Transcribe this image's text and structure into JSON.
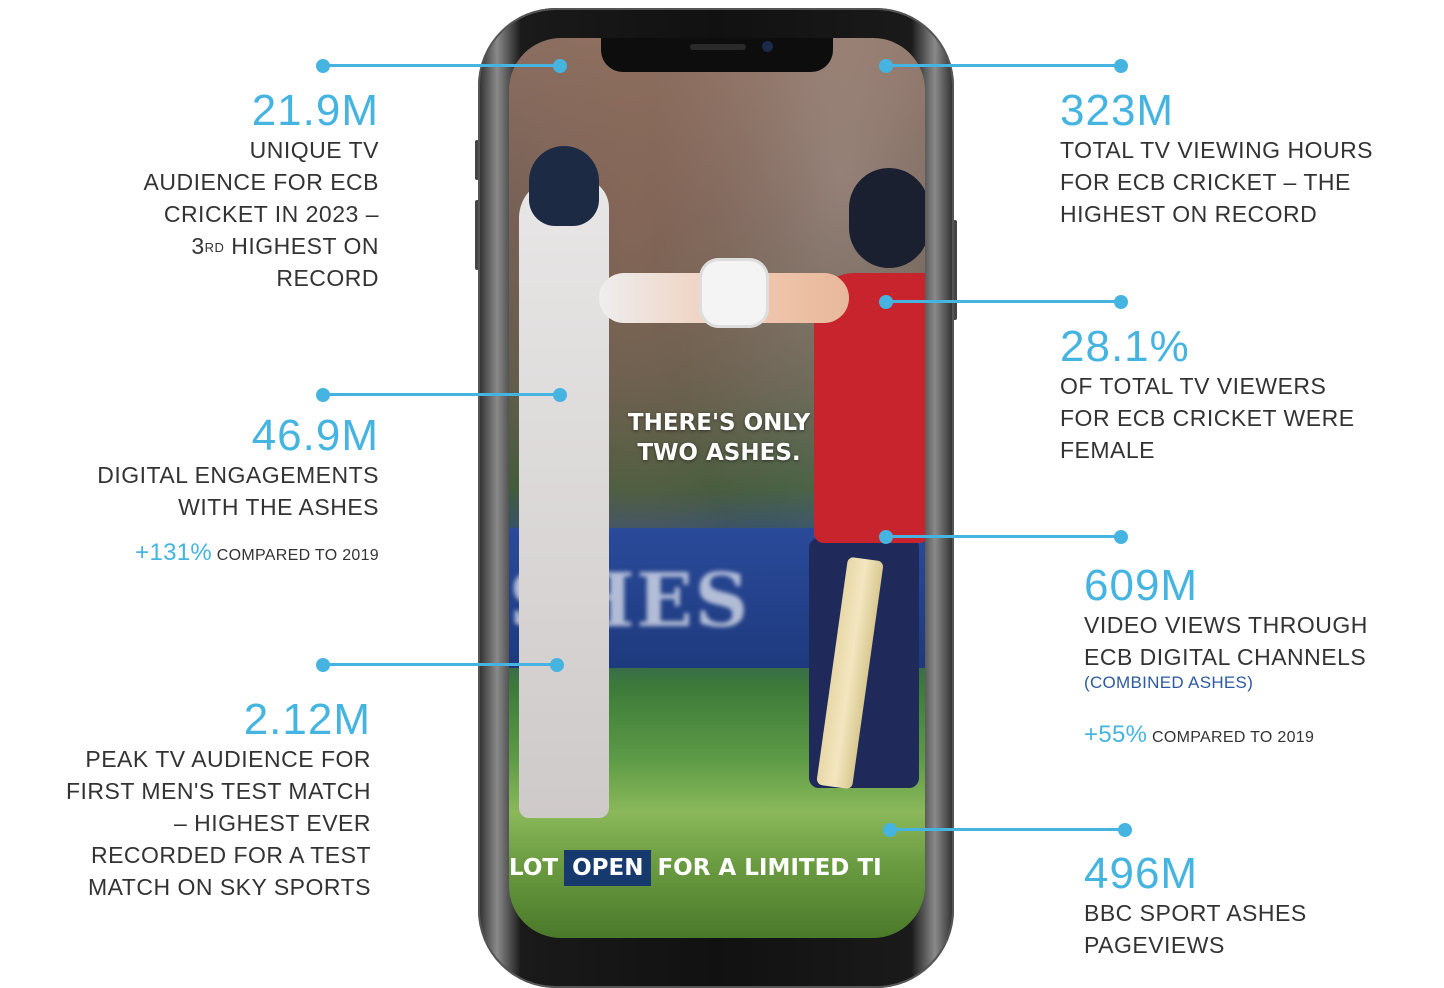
{
  "stats": {
    "s1": {
      "value": "21.9M",
      "desc_lines": [
        "UNIQUE TV",
        "AUDIENCE FOR ECB",
        "CRICKET IN 2023 –"
      ],
      "line4_pre": "3",
      "line4_sup": "RD",
      "line4_post": " HIGHEST ON",
      "line5": "RECORD"
    },
    "s2": {
      "value": "46.9M",
      "desc_lines": [
        "DIGITAL ENGAGEMENTS",
        "WITH THE ASHES"
      ],
      "pct": "+131%",
      "cmp": "COMPARED TO 2019"
    },
    "s3": {
      "value": "2.12M",
      "desc_lines": [
        "PEAK TV AUDIENCE FOR",
        "FIRST MEN'S TEST MATCH",
        "– HIGHEST EVER",
        "RECORDED FOR A TEST",
        "MATCH ON SKY SPORTS"
      ]
    },
    "s4": {
      "value": "323M",
      "desc_lines": [
        "TOTAL TV VIEWING HOURS",
        "FOR ECB CRICKET – THE",
        "HIGHEST ON RECORD"
      ]
    },
    "s5": {
      "value": "28.1%",
      "desc_lines": [
        "OF TOTAL TV VIEWERS",
        "FOR ECB CRICKET WERE",
        "FEMALE"
      ]
    },
    "s6": {
      "value": "609M",
      "desc_lines": [
        "VIDEO VIEWS THROUGH",
        "ECB DIGITAL  CHANNELS"
      ],
      "sub": "(COMBINED ASHES)",
      "pct": "+55%",
      "cmp": "COMPARED TO 2019"
    },
    "s7": {
      "value": "496M",
      "desc_lines": [
        "BBC SPORT ASHES",
        "PAGEVIEWS"
      ]
    }
  },
  "phone": {
    "tagline_1": "THERE'S ONLY",
    "tagline_2": "TWO ASHES.",
    "board_text": "SHES",
    "ticker_pre": "LOT",
    "ticker_open": "OPEN",
    "ticker_post": "FOR A LIMITED TI"
  },
  "colors": {
    "accent": "#45b4e0",
    "text": "#333333",
    "sub": "#2c5aa0"
  }
}
